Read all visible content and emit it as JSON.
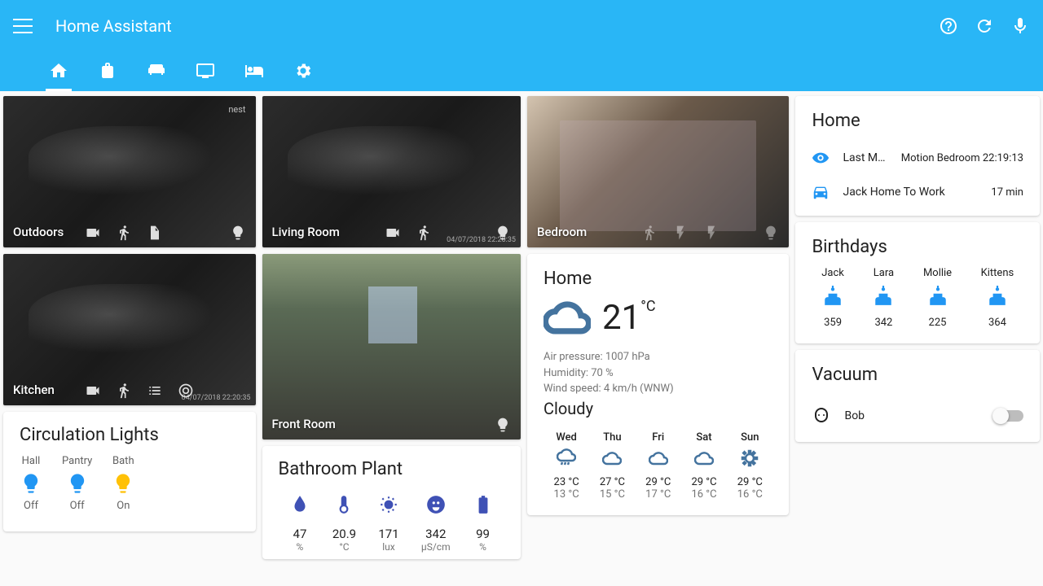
{
  "app": {
    "title": "Home Assistant"
  },
  "cameras": {
    "outdoors": {
      "label": "Outdoors",
      "nest": "nest"
    },
    "living": {
      "label": "Living Room",
      "timestamp": "04/07/2018 22:20:35"
    },
    "bedroom": {
      "label": "Bedroom"
    },
    "kitchen": {
      "label": "Kitchen",
      "timestamp": "04/07/2018 22:20:35"
    },
    "front": {
      "label": "Front Room"
    }
  },
  "circulation": {
    "title": "Circulation Lights",
    "lights": [
      {
        "name": "Hall",
        "state": "Off"
      },
      {
        "name": "Pantry",
        "state": "Off"
      },
      {
        "name": "Bath",
        "state": "On"
      }
    ]
  },
  "plant": {
    "title": "Bathroom Plant",
    "items": [
      {
        "icon": "moisture",
        "value": "47",
        "unit": "%"
      },
      {
        "icon": "temperature",
        "value": "20.9",
        "unit": "°C"
      },
      {
        "icon": "brightness",
        "value": "171",
        "unit": "lux"
      },
      {
        "icon": "conductivity",
        "value": "342",
        "unit": "µS/cm"
      },
      {
        "icon": "battery",
        "value": "99",
        "unit": "%"
      }
    ]
  },
  "weather": {
    "title": "Home",
    "temp": "21",
    "temp_unit": "°C",
    "pressure": "Air pressure: 1007 hPa",
    "humidity": "Humidity: 70 %",
    "wind": "Wind speed: 4 km/h (WNW)",
    "condition": "Cloudy",
    "forecast": [
      {
        "day": "Wed",
        "hi": "23 °C",
        "lo": "13 °C",
        "icon": "rain"
      },
      {
        "day": "Thu",
        "hi": "27 °C",
        "lo": "15 °C",
        "icon": "cloud"
      },
      {
        "day": "Fri",
        "hi": "29 °C",
        "lo": "17 °C",
        "icon": "cloud"
      },
      {
        "day": "Sat",
        "hi": "29 °C",
        "lo": "16 °C",
        "icon": "cloud"
      },
      {
        "day": "Sun",
        "hi": "29 °C",
        "lo": "16 °C",
        "icon": "sun"
      }
    ]
  },
  "home": {
    "title": "Home",
    "rows": [
      {
        "icon": "eye",
        "label": "Last Motion …",
        "value": "Motion Bedroom 22:19:13"
      },
      {
        "icon": "car",
        "label": "Jack Home To Work",
        "value": "17 min"
      }
    ]
  },
  "birthdays": {
    "title": "Birthdays",
    "items": [
      {
        "name": "Jack",
        "days": "359"
      },
      {
        "name": "Lara",
        "days": "342"
      },
      {
        "name": "Mollie",
        "days": "225"
      },
      {
        "name": "Kittens",
        "days": "364"
      }
    ]
  },
  "vacuum": {
    "title": "Vacuum",
    "name": "Bob"
  }
}
